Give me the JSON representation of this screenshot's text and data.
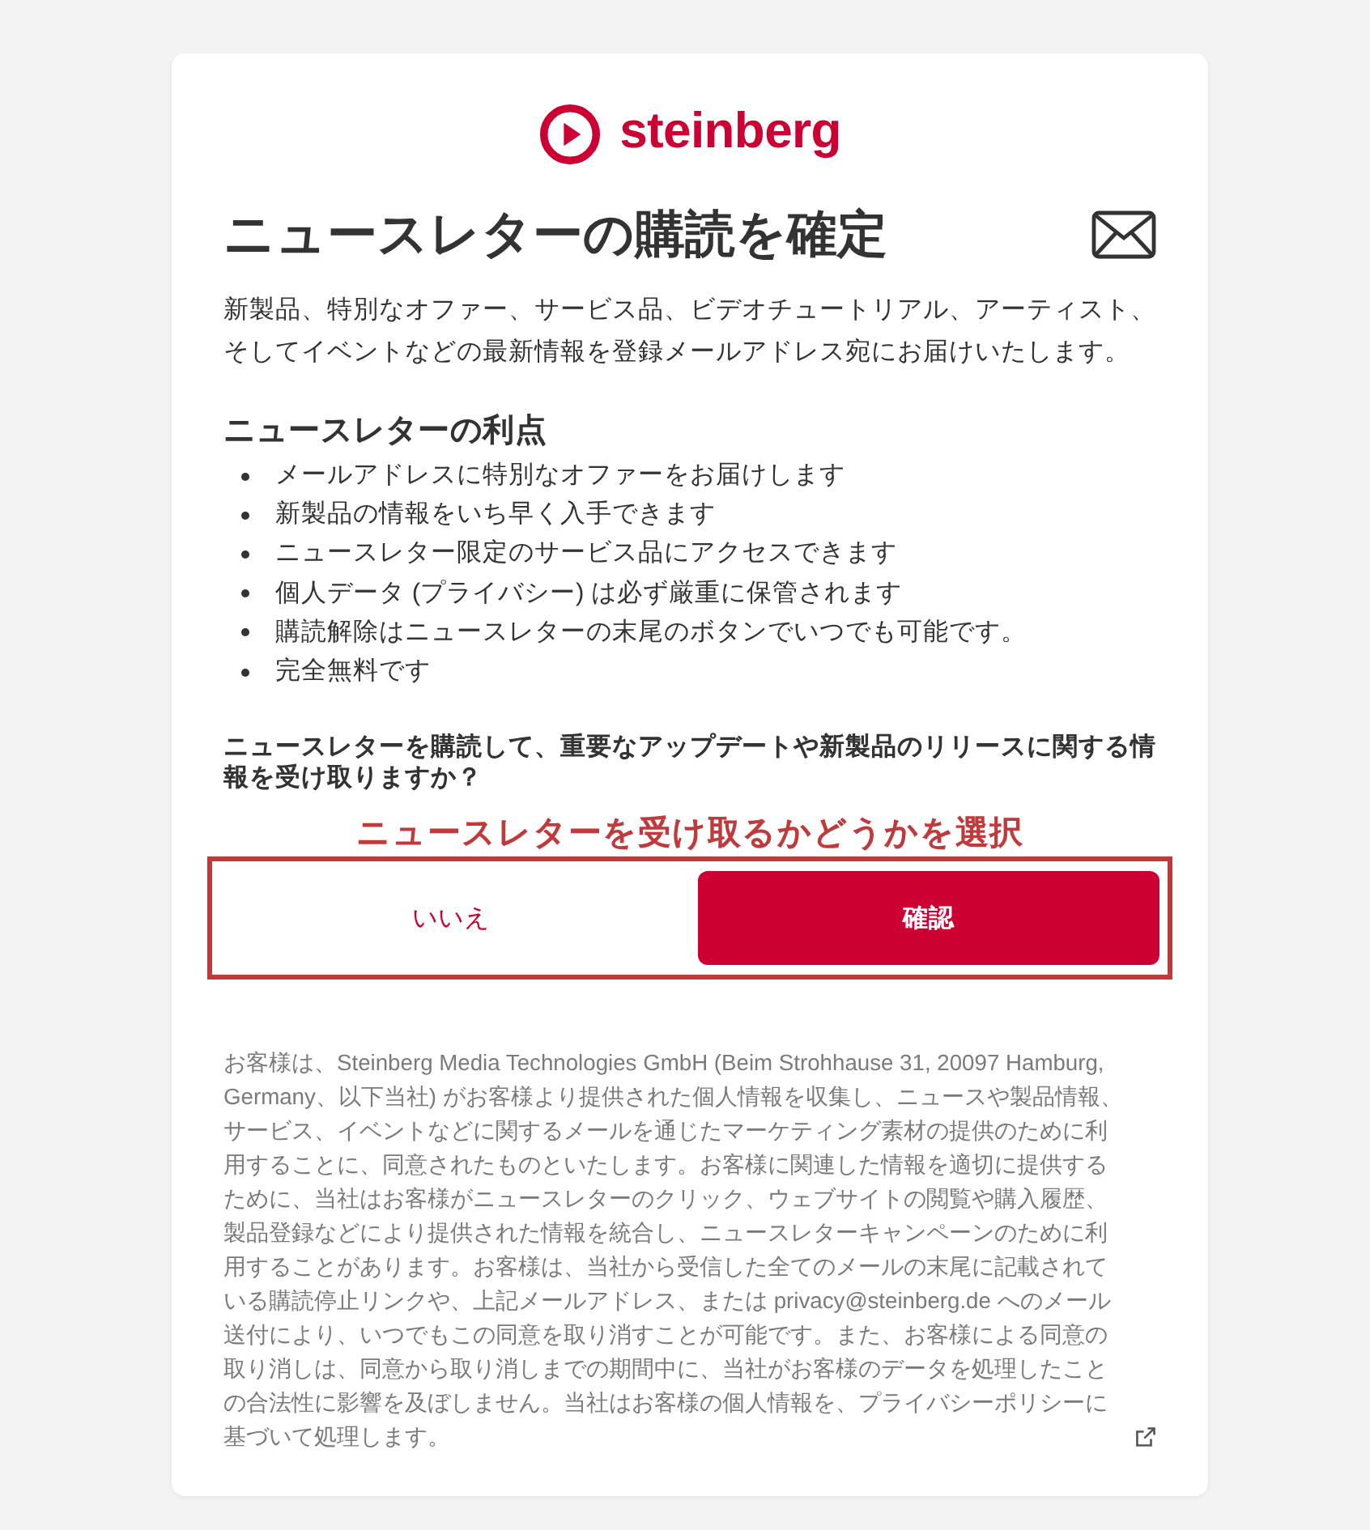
{
  "logo": {
    "text": "steinberg"
  },
  "title": "ニュースレターの購読を確定",
  "intro": "新製品、特別なオファー、サービス品、ビデオチュートリアル、アーティスト、そしてイベントなどの最新情報を登録メールアドレス宛にお届けいたします。",
  "benefits": {
    "heading": "ニュースレターの利点",
    "items": [
      "メールアドレスに特別なオファーをお届けします",
      "新製品の情報をいち早く入手できます",
      "ニュースレター限定のサービス品にアクセスできます",
      "個人データ (プライバシー) は必ず厳重に保管されます",
      "購読解除はニュースレターの末尾のボタンでいつでも可能です。",
      "完全無料です"
    ]
  },
  "question": "ニュースレターを購読して、重要なアップデートや新製品のリリースに関する情報を受け取りますか？",
  "choice_prompt": "ニュースレターを受け取るかどうかを選択",
  "buttons": [
    {
      "label": "いいえ",
      "kind": "secondary"
    },
    {
      "label": "確認",
      "kind": "primary"
    }
  ],
  "legal_text": "お客様は、Steinberg Media Technologies GmbH (Beim Strohhause 31, 20097 Hamburg, Germany、以下当社) がお客様より提供された個人情報を収集し、ニュースや製品情報、サービス、イベントなどに関するメールを通じたマーケティング素材の提供のために利用することに、同意されたものといたします。お客様に関連した情報を適切に提供するために、当社はお客様がニュースレターのクリック、ウェブサイトの閲覧や購入履歴、製品登録などにより提供された情報を統合し、ニュースレターキャンペーンのために利用することがあります。お客様は、当社から受信した全てのメールの末尾に記載されている購読停止リンクや、上記メールアドレス、または privacy@steinberg.de へのメール送付により、いつでもこの同意を取り消すことが可能です。また、お客様による同意の取り消しは、同意から取り消しまでの期間中に、当社がお客様のデータを処理したことの合法性に影響を及ぼしません。当社はお客様の個人情報を、プライバシーポリシーに基づいて処理します。"
}
